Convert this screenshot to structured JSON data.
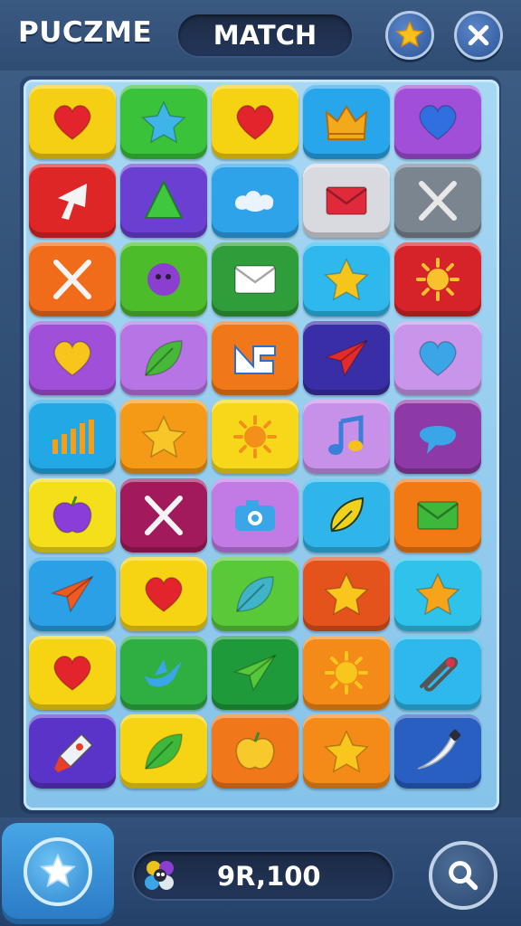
{
  "header": {
    "app_title": "PUCZME",
    "mode_label": "MATCH",
    "buttons": [
      {
        "name": "favorites-button",
        "icon": "star-icon"
      },
      {
        "name": "close-button",
        "icon": "close-icon"
      }
    ]
  },
  "board": {
    "rows": 9,
    "cols": 5,
    "tiles": [
      {
        "color": "#f5cf14",
        "icon": "heart-icon",
        "fg": "#e2242d"
      },
      {
        "color": "#39c23a",
        "icon": "star-icon",
        "fg": "#3fb4e8"
      },
      {
        "color": "#f5d212",
        "icon": "heart-icon",
        "fg": "#e2242d"
      },
      {
        "color": "#27a6ec",
        "icon": "crown-icon",
        "fg": "#f2a91c"
      },
      {
        "color": "#a14fd8",
        "icon": "heart-icon",
        "fg": "#2f6fe0"
      },
      {
        "color": "#de2626",
        "icon": "arrow-icon",
        "fg": "#f4f4f4"
      },
      {
        "color": "#6a3fd2",
        "icon": "triangle-icon",
        "fg": "#3fc83f"
      },
      {
        "color": "#2ea3ea",
        "icon": "cloud-icon",
        "fg": "#eaf3fb"
      },
      {
        "color": "#d8dadf",
        "icon": "envelope-icon",
        "fg": "#e02a3c"
      },
      {
        "color": "#7b8590",
        "icon": "cross-icon",
        "fg": "#e8e8e8"
      },
      {
        "color": "#f06c1b",
        "icon": "cross-icon",
        "fg": "#f4f4f4"
      },
      {
        "color": "#4cbc2b",
        "icon": "ball-icon",
        "fg": "#8a3fd0"
      },
      {
        "color": "#2f9e3a",
        "icon": "envelope-icon",
        "fg": "#ffffff"
      },
      {
        "color": "#2fb8ec",
        "icon": "star-icon",
        "fg": "#f6c51b"
      },
      {
        "color": "#d6232a",
        "icon": "sun-icon",
        "fg": "#f7c22b"
      },
      {
        "color": "#a050d8",
        "icon": "heart-icon",
        "fg": "#f7c51c"
      },
      {
        "color": "#b774e4",
        "icon": "leaf-icon",
        "fg": "#47b83a"
      },
      {
        "color": "#f07818",
        "icon": "logo-icon",
        "fg": "#ffffff"
      },
      {
        "color": "#3a2ea6",
        "icon": "plane-icon",
        "fg": "#e32b2b"
      },
      {
        "color": "#c995ea",
        "icon": "heart-icon",
        "fg": "#3aa6e8"
      },
      {
        "color": "#23a8e6",
        "icon": "chart-icon",
        "fg": "#f2a01c"
      },
      {
        "color": "#f59a17",
        "icon": "star-icon",
        "fg": "#f8c628"
      },
      {
        "color": "#f6d71a",
        "icon": "sun-icon",
        "fg": "#f29019"
      },
      {
        "color": "#c791ea",
        "icon": "music-icon",
        "fg": "#3a7fd8"
      },
      {
        "color": "#8e3aa6",
        "icon": "chat-icon",
        "fg": "#3aa6e8"
      },
      {
        "color": "#f5de1a",
        "icon": "apple-icon",
        "fg": "#8a3dd8"
      },
      {
        "color": "#a31a5c",
        "icon": "cross-icon",
        "fg": "#f4f4f4"
      },
      {
        "color": "#c27ae4",
        "icon": "camera-icon",
        "fg": "#3aa6e8"
      },
      {
        "color": "#2fb5ea",
        "icon": "pen-icon",
        "fg": "#f0d21c"
      },
      {
        "color": "#f27a14",
        "icon": "envelope-icon",
        "fg": "#3db83a"
      },
      {
        "color": "#2ca0e6",
        "icon": "plane-icon",
        "fg": "#f05a22"
      },
      {
        "color": "#f6d414",
        "icon": "heart-icon",
        "fg": "#e2242d"
      },
      {
        "color": "#59c93a",
        "icon": "leaf-icon",
        "fg": "#3fb4c8"
      },
      {
        "color": "#e5531d",
        "icon": "star-icon",
        "fg": "#f9c61e"
      },
      {
        "color": "#2fc2ea",
        "icon": "star-icon",
        "fg": "#f6a51b"
      },
      {
        "color": "#f6d414",
        "icon": "heart-icon",
        "fg": "#e2242d"
      },
      {
        "color": "#2fae42",
        "icon": "bird-icon",
        "fg": "#3aa6e8"
      },
      {
        "color": "#1f9a3a",
        "icon": "plane-icon",
        "fg": "#56c93a"
      },
      {
        "color": "#f48a18",
        "icon": "sun-icon",
        "fg": "#f9c61e"
      },
      {
        "color": "#2fb8ec",
        "icon": "clip-icon",
        "fg": "#d8354a"
      },
      {
        "color": "#5a34c8",
        "icon": "rocket-icon",
        "fg": "#e6402a"
      },
      {
        "color": "#f6d414",
        "icon": "leaf-icon",
        "fg": "#3db83a"
      },
      {
        "color": "#f0781a",
        "icon": "apple-icon",
        "fg": "#f8c92a"
      },
      {
        "color": "#f48a18",
        "icon": "star-icon",
        "fg": "#f9c61e"
      },
      {
        "color": "#2a5fc2",
        "icon": "blade-icon",
        "fg": "#eef2f6"
      }
    ]
  },
  "footer": {
    "power_icon": "star-icon",
    "score_icon": "balls-icon",
    "score": "9R,100",
    "search_icon": "search-icon"
  }
}
